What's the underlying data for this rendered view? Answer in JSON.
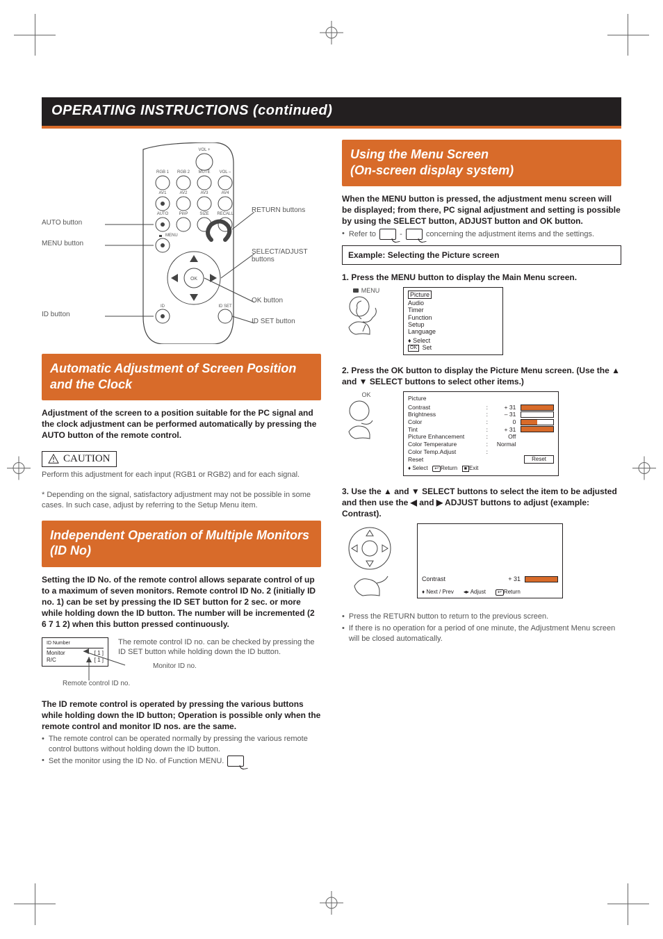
{
  "page_title": "OPERATING INSTRUCTIONS (continued)",
  "remote": {
    "labels": {
      "auto_button": "AUTO button",
      "menu_button": "MENU button",
      "id_button": "ID button",
      "return_buttons": "RETURN buttons",
      "select_adjust": "SELECT/ADJUST buttons",
      "ok_button": "OK button",
      "id_set_button": "ID SET button"
    },
    "keys": {
      "vol_plus": "VOL +",
      "vol_minus": "VOL –",
      "mute": "MUTE",
      "rgb1": "RGB 1",
      "rgb2": "RGB 2",
      "av1": "AV1",
      "av2": "AV2",
      "av3": "AV3",
      "av4": "AV4",
      "auto": "AUTO",
      "pinp": "PinP",
      "size": "SIZE",
      "recall": "RECALL",
      "menu": "MENU",
      "ok": "OK",
      "id": "ID",
      "id_set": "ID SET"
    }
  },
  "left": {
    "sec1_title": "Automatic Adjustment of Screen Position and the Clock",
    "sec1_body": "Adjustment of the screen to a position suitable for the PC signal and the clock adjustment can be performed automatically by pressing the AUTO button of the remote control.",
    "caution_label": "CAUTION",
    "caution_body": "Perform this adjustment for each input (RGB1 or RGB2) and for each signal.",
    "note_body": "* Depending on the signal, satisfactory adjustment may not be possible in some cases. In such case, adjust by referring to the Setup Menu item.",
    "sec2_title": "Independent Operation of Multiple Monitors (ID No)",
    "sec2_body": "Setting the ID No. of the remote control allows separate control of up to a maximum of seven monitors. Remote control ID No. 2 (initially ID no. 1) can be set by pressing the ID SET button for 2 sec. or more while holding down the ID button.  The number will be incremented (2   6   7   1   2) when this button pressed continuously.",
    "id_tip": "The remote control ID no. can be checked by pressing the ID SET button while holding down the ID button.",
    "id_box": {
      "title": "ID Number",
      "monitor": "Monitor",
      "rc": "R/C",
      "monitor_val": "[ 1 ]",
      "rc_val": "[ 1 ]"
    },
    "id_monitor_label": "Monitor ID no.",
    "id_rc_label": "Remote control ID no.",
    "sec2_body2": "The ID remote control is operated by pressing the various buttons while holding down the ID button; Operation is possible only when the remote control and monitor ID nos. are the same.",
    "sec2_bullet1": "The remote control can be operated normally by pressing the various remote control buttons without holding down the ID button.",
    "sec2_bullet2": "Set the monitor using the ID No. of Function MENU."
  },
  "right": {
    "sec_title_line1": "Using the Menu Screen",
    "sec_title_line2": "(On-screen display system)",
    "intro": "When the MENU button is pressed, the adjustment menu screen will be displayed; from there, PC signal adjustment and setting is possible by using the SELECT button, ADJUST button and OK button.",
    "refer": "Refer to",
    "refer2": "concerning the adjustment items and the settings.",
    "example": "Example: Selecting the Picture screen",
    "step1": "1. Press the MENU button to display the Main Menu screen.",
    "menu_label": "MENU",
    "main_menu": [
      "Picture",
      "Audio",
      "Timer",
      "Function",
      "Setup",
      "Language"
    ],
    "main_hints": {
      "select": "Select",
      "set": "Set",
      "ok": "OK"
    },
    "step2": "2. Press the OK button to display the Picture Menu screen. (Use the ▲ and ▼ SELECT buttons to select other items.)",
    "ok_label": "OK",
    "picture_menu": {
      "title": "Picture",
      "rows": [
        {
          "label": "Contrast",
          "value": "+ 31",
          "fill": 100
        },
        {
          "label": "Brightness",
          "value": "– 31",
          "fill": 0
        },
        {
          "label": "Color",
          "value": "0",
          "fill": 50
        },
        {
          "label": "Tint",
          "value": "+ 31",
          "fill": 100
        },
        {
          "label": "Picture Enhancement",
          "value": "Off"
        },
        {
          "label": "Color Temperature",
          "value": "Normal"
        },
        {
          "label": "Color Temp.Adjust",
          "value": ""
        }
      ],
      "reset": "Reset",
      "hints": {
        "select": "Select",
        "return": "Return",
        "exit": "Exit"
      }
    },
    "step3": "3. Use the ▲ and ▼ SELECT buttons to select the item to be adjusted and then use the ◀ and ▶ ADJUST buttons to adjust (example: Contrast).",
    "contrast_box": {
      "label": "Contrast",
      "value": "+ 31",
      "hints": {
        "next": "Next / Prev",
        "adjust": "Adjust",
        "return": "Return"
      }
    },
    "tail_bullet1": "Press the RETURN button to return to the previous screen.",
    "tail_bullet2": "If there is no operation for a period of one minute, the Adjustment Menu screen will be closed automatically."
  }
}
